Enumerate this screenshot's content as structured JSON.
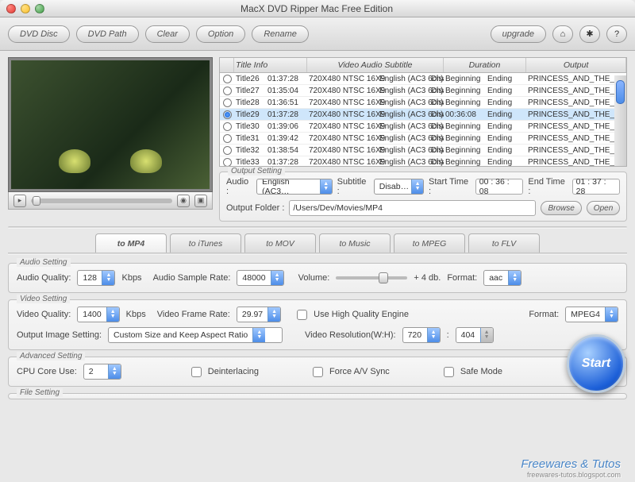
{
  "window": {
    "title": "MacX DVD Ripper Mac Free Edition"
  },
  "toolbar": {
    "dvd_disc": "DVD Disc",
    "dvd_path": "DVD Path",
    "clear": "Clear",
    "option": "Option",
    "rename": "Rename",
    "upgrade": "upgrade"
  },
  "table": {
    "headers": {
      "title_info": "Title Info",
      "vas": "Video Audio Subtitle",
      "duration": "Duration",
      "output": "Output"
    },
    "rows": [
      {
        "selected": false,
        "name": "Title26",
        "dur": "01:37:28",
        "res": "720X480 NTSC 16X9",
        "aud": "English (AC3 6ch)",
        "sub": "Disabled",
        "begin": "Beginning",
        "end": "Ending",
        "out": "PRINCESS_AND_THE_FR"
      },
      {
        "selected": false,
        "name": "Title27",
        "dur": "01:35:04",
        "res": "720X480 NTSC 16X9",
        "aud": "English (AC3 6ch)",
        "sub": "Disabled",
        "begin": "Beginning",
        "end": "Ending",
        "out": "PRINCESS_AND_THE_FR"
      },
      {
        "selected": false,
        "name": "Title28",
        "dur": "01:36:51",
        "res": "720X480 NTSC 16X9",
        "aud": "English (AC3 6ch)",
        "sub": "Disabled",
        "begin": "Beginning",
        "end": "Ending",
        "out": "PRINCESS_AND_THE_FR"
      },
      {
        "selected": true,
        "name": "Title29",
        "dur": "01:37:28",
        "res": "720X480 NTSC 16X9",
        "aud": "English (AC3 6ch)",
        "sub": "Disabled",
        "begin": "00:36:08",
        "end": "Ending",
        "out": "PRINCESS_AND_THE_FR"
      },
      {
        "selected": false,
        "name": "Title30",
        "dur": "01:39:06",
        "res": "720X480 NTSC 16X9",
        "aud": "English (AC3 6ch)",
        "sub": "Disabled",
        "begin": "Beginning",
        "end": "Ending",
        "out": "PRINCESS_AND_THE_FR"
      },
      {
        "selected": false,
        "name": "Title31",
        "dur": "01:39:42",
        "res": "720X480 NTSC 16X9",
        "aud": "English (AC3 6ch)",
        "sub": "Disabled",
        "begin": "Beginning",
        "end": "Ending",
        "out": "PRINCESS_AND_THE_FR"
      },
      {
        "selected": false,
        "name": "Title32",
        "dur": "01:38:54",
        "res": "720X480 NTSC 16X9",
        "aud": "English (AC3 6ch)",
        "sub": "Disabled",
        "begin": "Beginning",
        "end": "Ending",
        "out": "PRINCESS_AND_THE_FR"
      },
      {
        "selected": false,
        "name": "Title33",
        "dur": "01:37:28",
        "res": "720X480 NTSC 16X9",
        "aud": "English (AC3 6ch)",
        "sub": "Disabled",
        "begin": "Beginning",
        "end": "Ending",
        "out": "PRINCESS_AND_THE_FR"
      }
    ]
  },
  "output_setting": {
    "legend": "Output Setting",
    "audio_label": "Audio :",
    "audio_value": "English (AC3…",
    "subtitle_label": "Subtitle :",
    "subtitle_value": "Disab…",
    "start_time_label": "Start Time :",
    "start_time_value": "00 : 36 : 08",
    "end_time_label": "End Time :",
    "end_time_value": "01 : 37 : 28",
    "folder_label": "Output Folder :",
    "folder_value": "/Users/Dev/Movies/MP4",
    "browse": "Browse",
    "open": "Open"
  },
  "tabs": [
    {
      "label": "to MP4",
      "active": true
    },
    {
      "label": "to iTunes",
      "active": false
    },
    {
      "label": "to MOV",
      "active": false
    },
    {
      "label": "to Music",
      "active": false
    },
    {
      "label": "to MPEG",
      "active": false
    },
    {
      "label": "to FLV",
      "active": false
    }
  ],
  "audio_setting": {
    "legend": "Audio Setting",
    "quality_label": "Audio Quality:",
    "quality_value": "128",
    "kbps": "Kbps",
    "sample_label": "Audio Sample Rate:",
    "sample_value": "48000",
    "volume_label": "Volume:",
    "volume_db": "+ 4 db.",
    "format_label": "Format:",
    "format_value": "aac"
  },
  "video_setting": {
    "legend": "Video Setting",
    "quality_label": "Video Quality:",
    "quality_value": "1400",
    "kbps": "Kbps",
    "frame_label": "Video Frame Rate:",
    "frame_value": "29.97",
    "hq_label": "Use High Quality Engine",
    "format_label": "Format:",
    "format_value": "MPEG4",
    "image_label": "Output Image Setting:",
    "image_value": "Custom Size and Keep Aspect Ratio",
    "res_label": "Video Resolution(W:H):",
    "res_w": "720",
    "res_h": "404"
  },
  "advanced_setting": {
    "legend": "Advanced Setting",
    "cpu_label": "CPU Core Use:",
    "cpu_value": "2",
    "deint_label": "Deinterlacing",
    "force_label": "Force A/V Sync",
    "safe_label": "Safe Mode"
  },
  "file_setting": {
    "legend": "File Setting"
  },
  "start_label": "Start",
  "watermark": {
    "brand": "Freewares & Tutos",
    "url": "freewares-tutos.blogspot.com"
  }
}
